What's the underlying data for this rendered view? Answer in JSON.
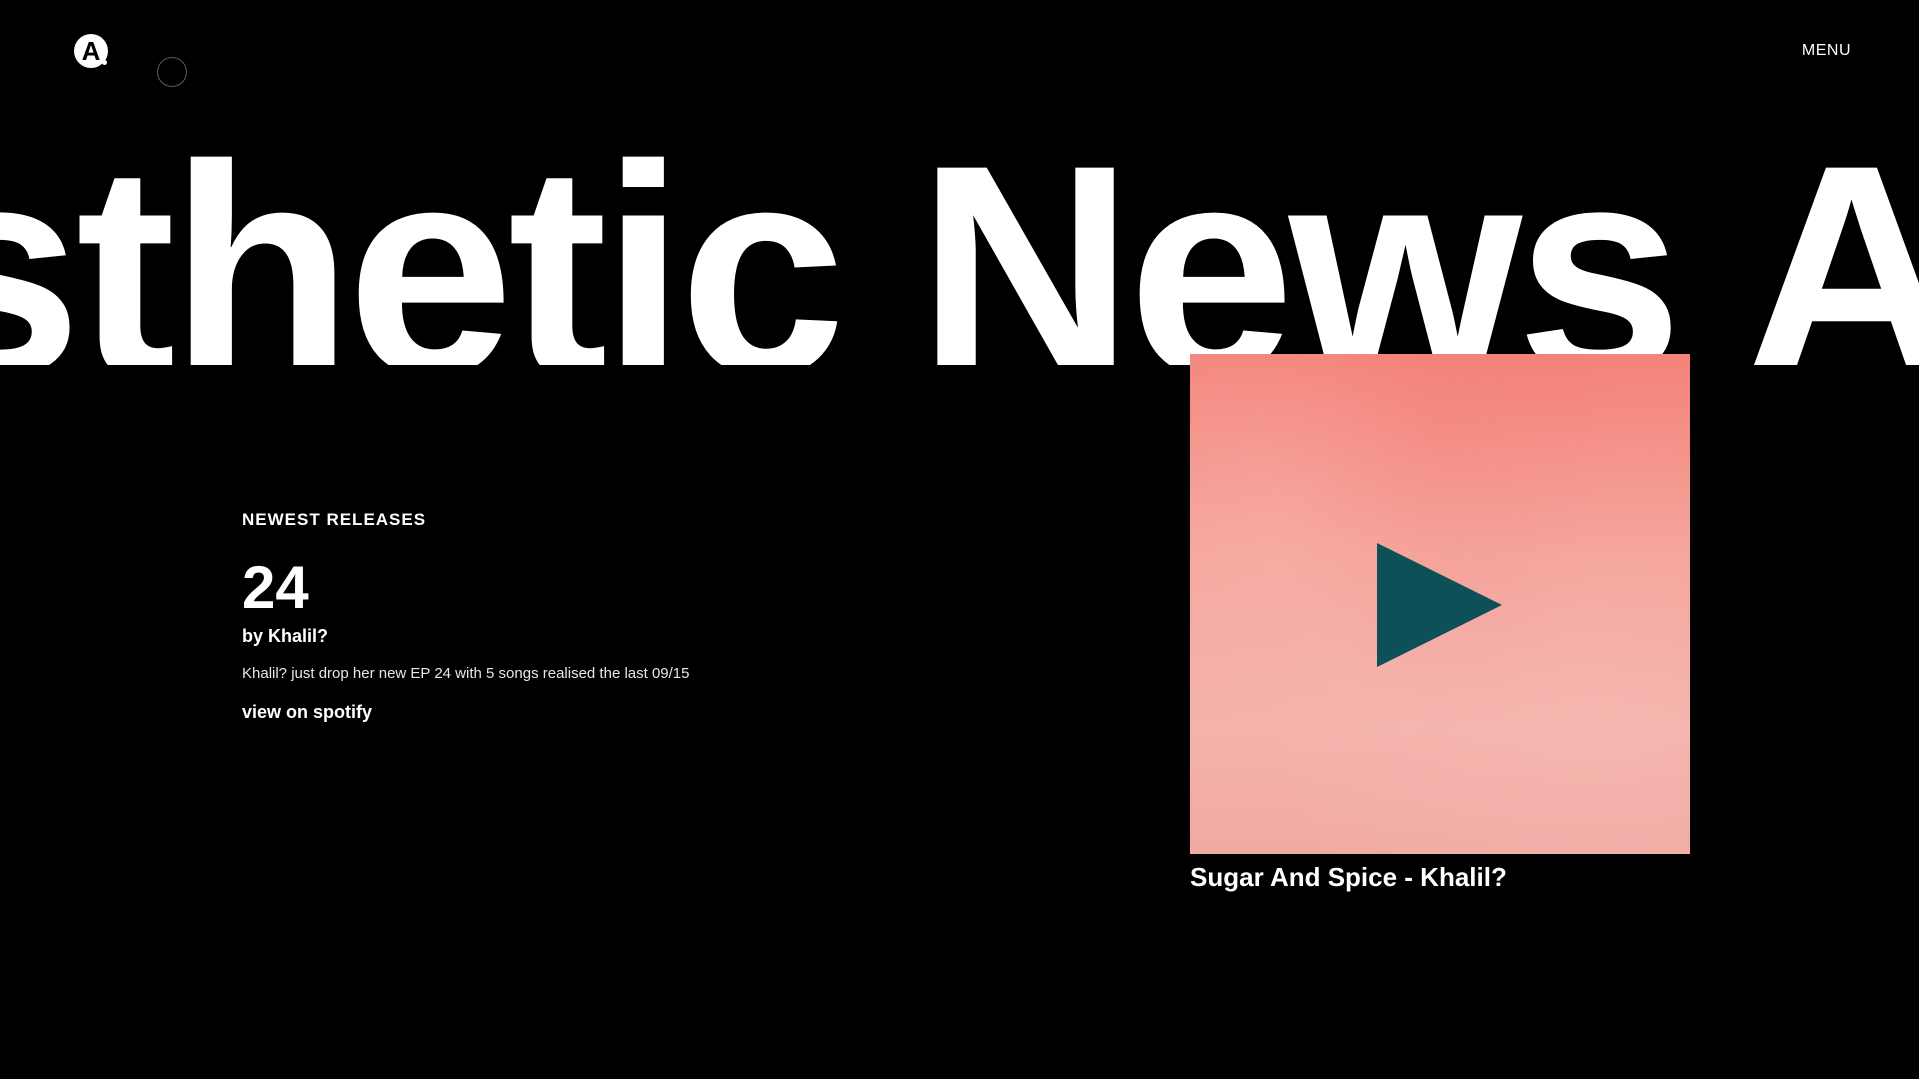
{
  "header": {
    "logo_letter": "A",
    "menu_label": "MENU"
  },
  "marquee": {
    "text": "sthetic News A"
  },
  "release": {
    "section_label": "NEWEST RELEASES",
    "title": "24",
    "artist": "by Khalil?",
    "description": "Khalil? just drop her new EP 24 with 5 songs realised the last 09/15",
    "link_label": "view on spotify"
  },
  "player": {
    "caption": "Sugar And Spice - Khalil?",
    "cover_colors": {
      "top": "#f4837a",
      "bottom": "#f0aaa3",
      "play_icon": "#0d5058"
    }
  }
}
